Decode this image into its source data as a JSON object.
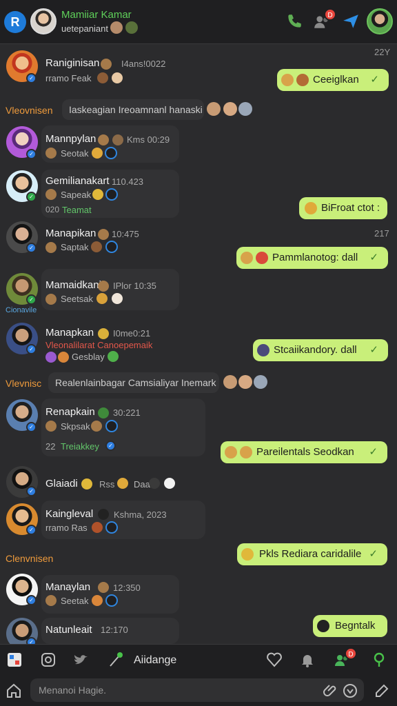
{
  "header": {
    "contact_name": "Mamiiar Kamar",
    "contact_status": "uetepaniant",
    "notification_badge": "D",
    "icons": [
      "app-logo-icon",
      "phone-icon",
      "contacts-icon",
      "send-icon"
    ]
  },
  "chat": {
    "top_time": "22Y",
    "sections": [
      {
        "label": "Vleovnisen",
        "bar_text": "Iaskeagian Ireoamnanl hanaski"
      },
      {
        "label": "Vlevnisc",
        "bar_text": "Realenlainbagar Camsialiyar Inemark"
      },
      {
        "label": "Clenvnisen"
      }
    ],
    "contacts": [
      {
        "name": "Raniginisan",
        "meta": "I4ans!0022",
        "sub": "rramo Feak",
        "accent": "#e07a2e"
      },
      {
        "name": "Mannpylan",
        "meta": "Kms 00:29",
        "sub": "Seotak",
        "accent": "#b25ad9"
      },
      {
        "name": "Gemilianakart",
        "meta": "110.423",
        "sub": "Sapeak",
        "extra_prefix": "020",
        "extra": "Teamat",
        "accent": "#3fa7d6"
      },
      {
        "name": "Manapikan",
        "meta": "10:475",
        "sub": "Saptak",
        "accent": "#4a4a4a"
      },
      {
        "name": "Mamaidkani",
        "meta": "IPlor 10:35",
        "sub": "Seetsak",
        "under_label": "Cionavile",
        "accent": "#6f8a3a"
      },
      {
        "name": "Manapkan",
        "meta": "I0me0:21",
        "sub": "Gesblay",
        "alert": "Vleonalilarat Canoepemaik",
        "accent": "#3a4f86"
      },
      {
        "name": "Renapkain",
        "meta": "30:221",
        "sub": "Skpsak",
        "extra_prefix": "22",
        "extra": "Treiakkey",
        "accent": "#5a7fb0"
      },
      {
        "name": "Glaiadi",
        "meta": "Rss",
        "sub": "Daa",
        "accent": "#3b3b3b"
      },
      {
        "name": "Kaingleval",
        "meta": "Kshma, 2023",
        "sub": "rramo Ras",
        "accent": "#d88a2f"
      },
      {
        "name": "Manaylan",
        "meta": "12:350",
        "sub": "Seetak",
        "accent": "#2f2f2f"
      },
      {
        "name": "Natunleait",
        "meta": "12:170",
        "sub": "",
        "accent": "#5a6e8a"
      }
    ],
    "outgoing": [
      {
        "text": "Ceeiglkan",
        "tick": "✓"
      },
      {
        "text": "BiFroat ctot :",
        "tick": ""
      },
      {
        "text": "Pammlanotog: dall",
        "tick": "✓",
        "time": "217"
      },
      {
        "text": "Stcaiikandory. dall",
        "tick": "✓"
      },
      {
        "text": "Pareilentals Seodkan",
        "tick": "✓"
      },
      {
        "text": "Pkls Rediara caridalile",
        "tick": "✓"
      },
      {
        "text": "Begntalk",
        "tick": ""
      }
    ]
  },
  "toolbar": {
    "label": "Aiidange",
    "badge": "D"
  },
  "composer": {
    "placeholder": "Menanoi Hagie."
  },
  "colors": {
    "accent_green": "#c9ef7a",
    "header_name": "#5fd15a",
    "section_orange": "#ef9b3c",
    "verify_blue": "#2e7ee0",
    "badge_red": "#e8453c"
  }
}
